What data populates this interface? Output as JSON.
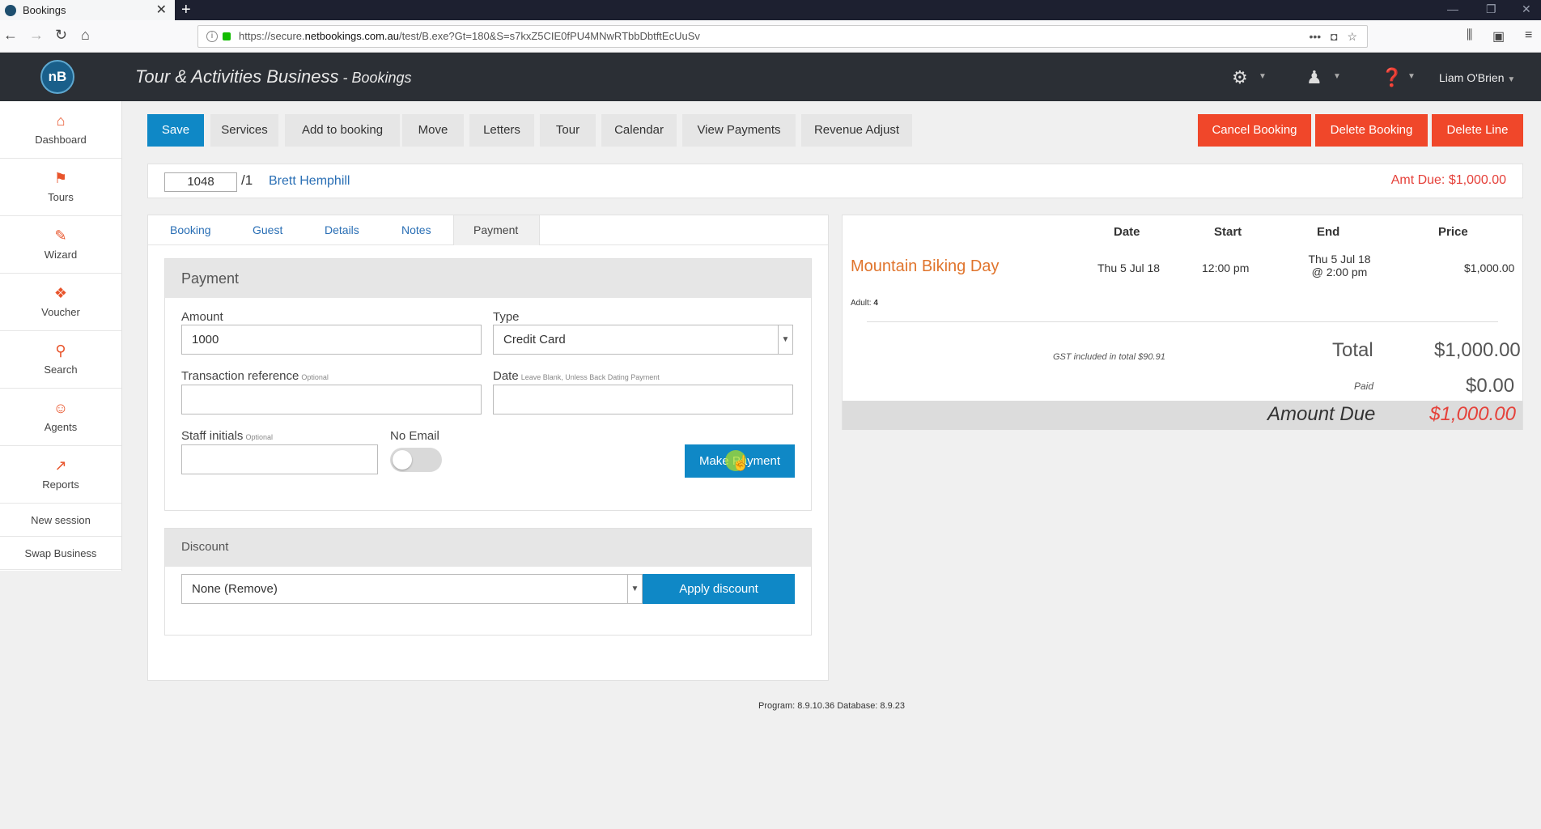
{
  "browser": {
    "tab_title": "Bookings",
    "url_prefix": "https://secure.",
    "url_domain": "netbookings.com.au",
    "url_path": "/test/B.exe?Gt=180&S=s7kxZ5CIE0fPU4MNwRTbbDbtftEcUuSv"
  },
  "header": {
    "logo_text": "nB",
    "title": "Tour & Activities Business",
    "title_sep": " - ",
    "subtitle": "Bookings",
    "user_name": "Liam O'Brien"
  },
  "sidebar": {
    "items": [
      {
        "label": "Dashboard",
        "icon": "dashboard-icon",
        "glyph": "⌂"
      },
      {
        "label": "Tours",
        "icon": "tours-icon",
        "glyph": "⚑"
      },
      {
        "label": "Wizard",
        "icon": "wizard-icon",
        "glyph": "✎"
      },
      {
        "label": "Voucher",
        "icon": "gift-icon",
        "glyph": "❖"
      },
      {
        "label": "Search",
        "icon": "search-icon",
        "glyph": "⚲"
      },
      {
        "label": "Agents",
        "icon": "agents-icon",
        "glyph": "☺"
      },
      {
        "label": "Reports",
        "icon": "reports-icon",
        "glyph": "↗"
      }
    ],
    "new_session": "New session",
    "swap_business": "Swap Business"
  },
  "toolbar": {
    "save": "Save",
    "services": "Services",
    "add_to_booking": "Add to booking",
    "move": "Move",
    "letters": "Letters",
    "tour": "Tour",
    "calendar": "Calendar",
    "view_payments": "View Payments",
    "revenue_adjust": "Revenue Adjust",
    "cancel_booking": "Cancel Booking",
    "delete_booking": "Delete Booking",
    "delete_line": "Delete Line"
  },
  "booking": {
    "ref": "1048",
    "suffix": "/1",
    "guest": "Brett Hemphill",
    "amt_due": "Amt Due: $1,000.00"
  },
  "tabs": [
    "Booking",
    "Guest",
    "Details",
    "Notes",
    "Payment"
  ],
  "payment": {
    "heading": "Payment",
    "amount_label": "Amount",
    "amount_value": "1000",
    "type_label": "Type",
    "type_value": "Credit Card",
    "txref_label": "Transaction reference",
    "optional": "Optional",
    "date_label": "Date",
    "date_hint": "Leave Blank, Unless Back Dating Payment",
    "staff_label": "Staff initials",
    "noemail_label": "No Email",
    "make_payment": "Make Payment"
  },
  "discount": {
    "heading": "Discount",
    "selected": "None (Remove)",
    "apply": "Apply discount"
  },
  "summary": {
    "col_date": "Date",
    "col_start": "Start",
    "col_end": "End",
    "col_price": "Price",
    "item_name": "Mountain Biking Day",
    "item_date": "Thu 5 Jul 18",
    "item_start": "12:00 pm",
    "item_end_line1": "Thu 5 Jul 18",
    "item_end_line2": "@ 2:00 pm",
    "item_price": "$1,000.00",
    "pax_label": "Adult:",
    "pax_value": "4",
    "gst_note": "GST included in total $90.91",
    "total_label": "Total",
    "total_value": "$1,000.00",
    "paid_label": "Paid",
    "paid_value": "$0.00",
    "due_label": "Amount Due",
    "due_value": "$1,000.00"
  },
  "footer": {
    "version": "Program: 8.9.10.36 Database: 8.9.23"
  }
}
